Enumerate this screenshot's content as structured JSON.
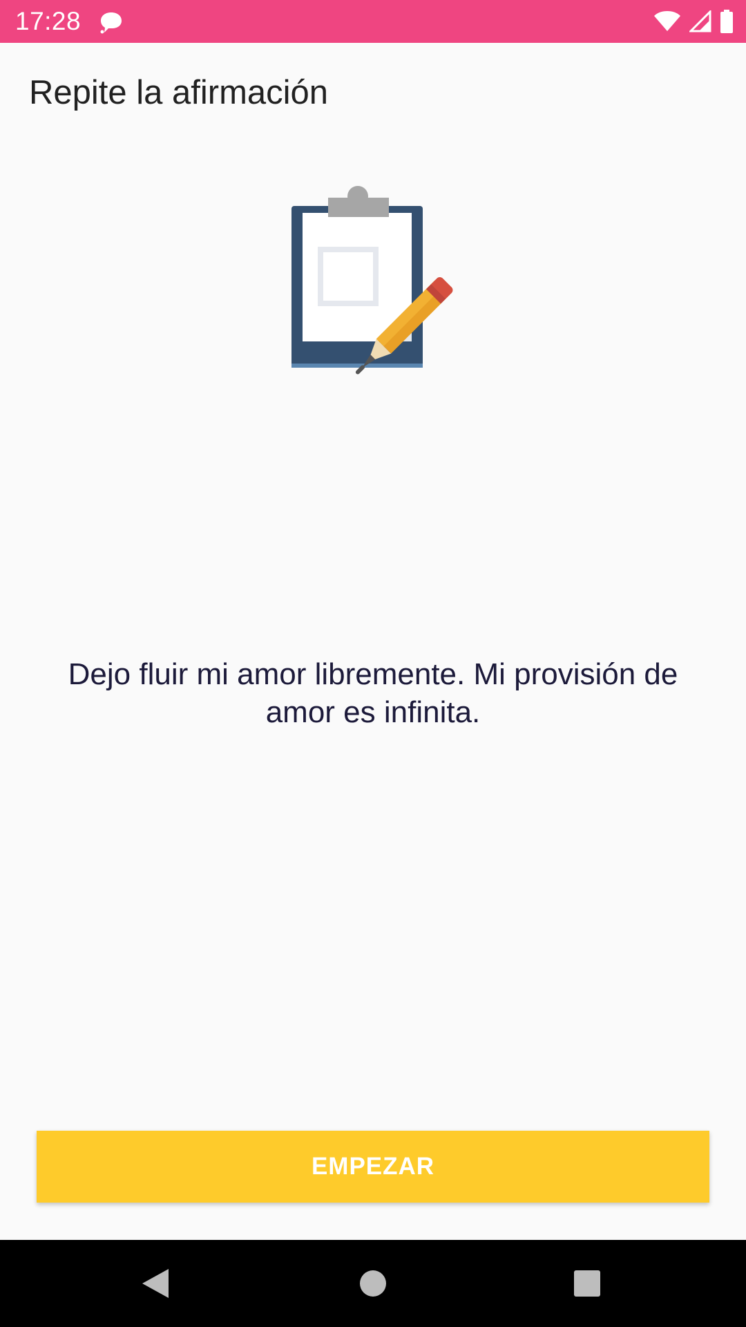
{
  "status_bar": {
    "time": "17:28",
    "notification_icon": "chat-bubble-icon",
    "icons": [
      "wifi-icon",
      "cell-signal-icon",
      "battery-icon"
    ],
    "background_color": "#ef4581"
  },
  "header": {
    "title": "Repite la afirmación"
  },
  "illustration": {
    "icon": "clipboard-pencil-icon"
  },
  "main": {
    "affirmation": "Dejo fluir mi amor libremente. Mi provisión de amor es infinita."
  },
  "actions": {
    "start_label": "EMPEZAR",
    "button_color": "#fecb2b"
  },
  "nav_bar": {
    "icons": [
      "back-icon",
      "home-icon",
      "recents-icon"
    ]
  }
}
